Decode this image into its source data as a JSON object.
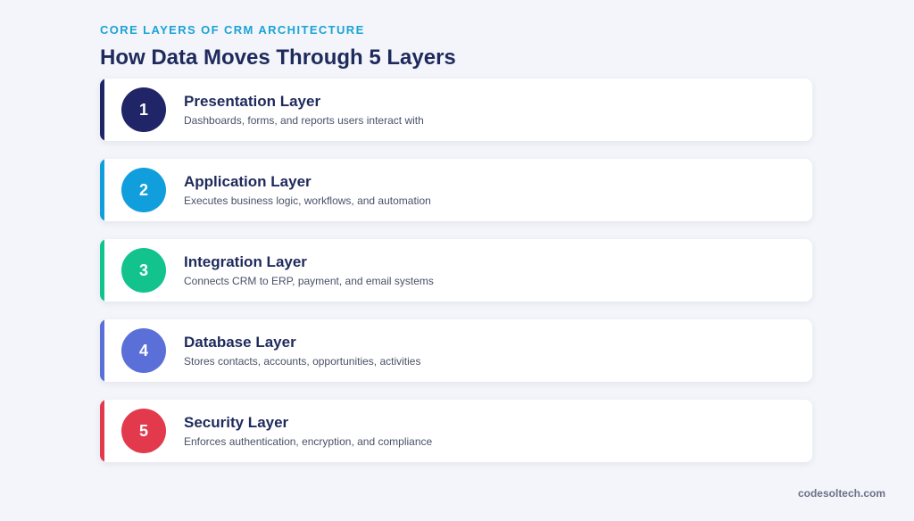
{
  "header": {
    "eyebrow": "CORE LAYERS OF CRM ARCHITECTURE",
    "title": "How Data Moves Through 5 Layers"
  },
  "layers": [
    {
      "number": "1",
      "title": "Presentation Layer",
      "description": "Dashboards, forms, and reports users interact with",
      "color": "#1f2566"
    },
    {
      "number": "2",
      "title": "Application Layer",
      "description": "Executes business logic, workflows, and automation",
      "color": "#109fdc"
    },
    {
      "number": "3",
      "title": "Integration Layer",
      "description": "Connects CRM to ERP, payment, and email systems",
      "color": "#12c38e"
    },
    {
      "number": "4",
      "title": "Database Layer",
      "description": "Stores contacts, accounts, opportunities, activities",
      "color": "#5b6fd8"
    },
    {
      "number": "5",
      "title": "Security Layer",
      "description": "Enforces authentication, encryption, and compliance",
      "color": "#e2394d"
    }
  ],
  "footer": {
    "brand": "codesoltech.com"
  }
}
